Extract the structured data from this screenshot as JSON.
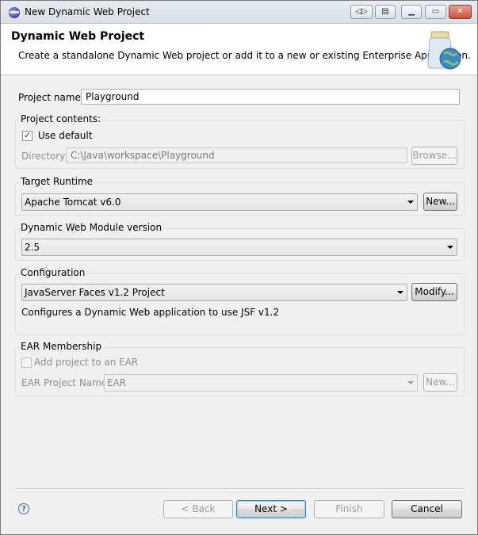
{
  "window": {
    "title": "New Dynamic Web Project"
  },
  "header": {
    "title": "Dynamic Web Project",
    "description": "Create a standalone Dynamic Web project or add it to a new or existing Enterprise Application."
  },
  "project_name": {
    "label": "Project name:",
    "value": "Playground"
  },
  "project_contents": {
    "group_label": "Project contents:",
    "use_default_label": "Use default",
    "use_default_checked": true,
    "directory_label": "Directory:",
    "directory_value": "C:\\Java\\workspace\\Playground",
    "browse_label": "Browse..."
  },
  "target_runtime": {
    "group_label": "Target Runtime",
    "selected": "Apache Tomcat v6.0",
    "new_label": "New..."
  },
  "module_version": {
    "group_label": "Dynamic Web Module version",
    "selected": "2.5"
  },
  "configuration": {
    "group_label": "Configuration",
    "selected": "JavaServer Faces v1.2 Project",
    "modify_label": "Modify...",
    "description": "Configures a Dynamic Web application to use JSF v1.2"
  },
  "ear": {
    "group_label": "EAR Membership",
    "add_label": "Add project to an EAR",
    "add_checked": false,
    "project_name_label": "EAR Project Name:",
    "project_name_value": "EAR",
    "new_label": "New..."
  },
  "footer": {
    "help": "?",
    "back": "< Back",
    "next": "Next >",
    "finish": "Finish",
    "cancel": "Cancel"
  }
}
